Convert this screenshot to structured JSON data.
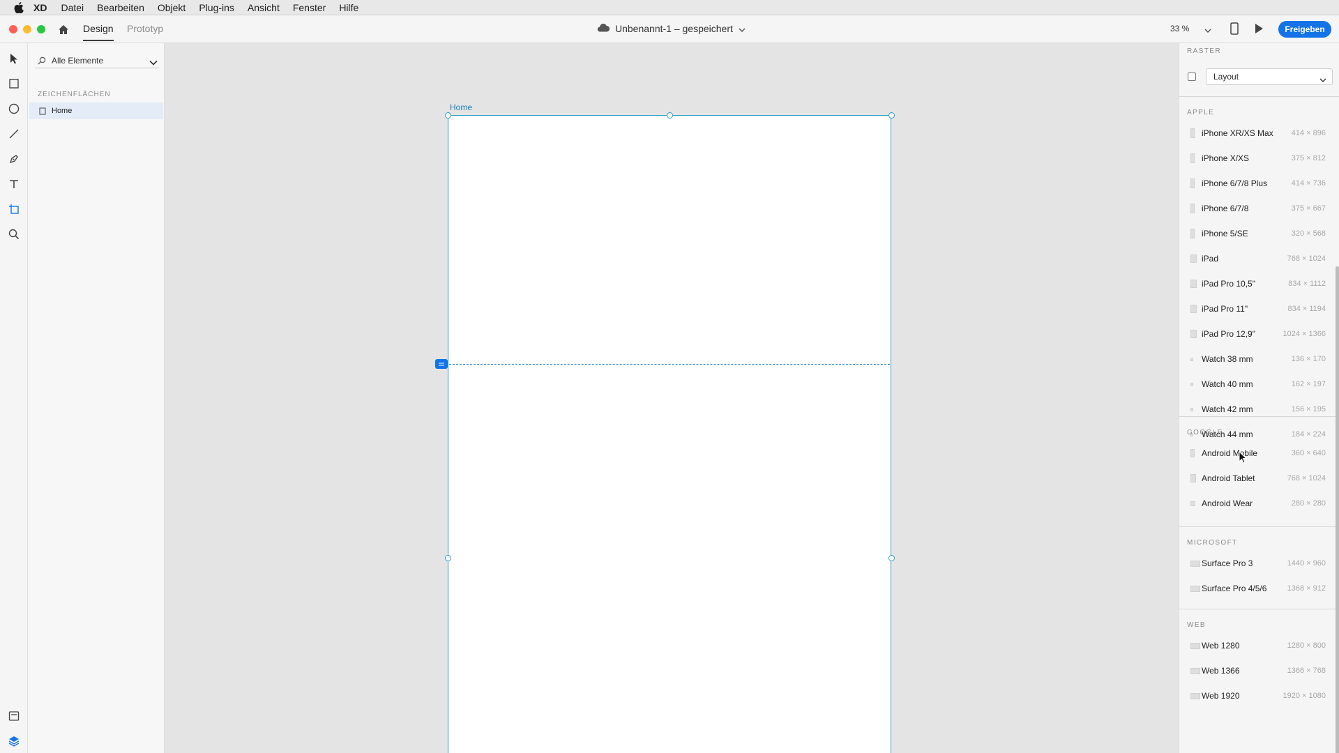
{
  "menubar": {
    "app": "XD",
    "items": [
      "Datei",
      "Bearbeiten",
      "Objekt",
      "Plug-ins",
      "Ansicht",
      "Fenster",
      "Hilfe"
    ]
  },
  "titlebar": {
    "tabs": {
      "design": "Design",
      "prototype": "Prototyp"
    },
    "document_title": "Unbenannt-1 – gespeichert",
    "zoom": "33 %",
    "share_label": "Freigeben",
    "colors": {
      "accent": "#1473e6",
      "close": "#ff5f57",
      "minimize": "#febc2e",
      "maximize": "#28c840"
    }
  },
  "layers": {
    "filter_label": "Alle Elemente",
    "section_label": "ZEICHENFLÄCHEN",
    "artboards": [
      "Home"
    ]
  },
  "canvas": {
    "artboard_name": "Home",
    "artboard_border_color": "#2aa0c9"
  },
  "inspector": {
    "grid_section": "RASTER",
    "grid_select": "Layout",
    "groups": [
      {
        "title": "APPLE",
        "presets": [
          {
            "name": "iPhone XR/XS Max",
            "size": "414 × 896"
          },
          {
            "name": "iPhone X/XS",
            "size": "375 × 812"
          },
          {
            "name": "iPhone 6/7/8 Plus",
            "size": "414 × 736"
          },
          {
            "name": "iPhone 6/7/8",
            "size": "375 × 667"
          },
          {
            "name": "iPhone 5/SE",
            "size": "320 × 568"
          },
          {
            "name": "iPad",
            "size": "768 × 1024"
          },
          {
            "name": "iPad Pro 10,5\"",
            "size": "834 × 1112"
          },
          {
            "name": "iPad Pro 11\"",
            "size": "834 × 1194"
          },
          {
            "name": "iPad Pro 12,9\"",
            "size": "1024 × 1366"
          },
          {
            "name": "Watch 38 mm",
            "size": "136 × 170"
          },
          {
            "name": "Watch 40 mm",
            "size": "162 × 197"
          },
          {
            "name": "Watch 42 mm",
            "size": "156 × 195"
          },
          {
            "name": "Watch 44 mm",
            "size": "184 × 224"
          }
        ]
      },
      {
        "title": "GOOGLE",
        "presets": [
          {
            "name": "Android Mobile",
            "size": "360 × 640"
          },
          {
            "name": "Android Tablet",
            "size": "768 × 1024"
          },
          {
            "name": "Android Wear",
            "size": "280 × 280"
          }
        ]
      },
      {
        "title": "MICROSOFT",
        "presets": [
          {
            "name": "Surface Pro 3",
            "size": "1440 × 960"
          },
          {
            "name": "Surface Pro 4/5/6",
            "size": "1368 × 912"
          }
        ]
      },
      {
        "title": "WEB",
        "presets": [
          {
            "name": "Web 1280",
            "size": "1280 × 800"
          },
          {
            "name": "Web 1366",
            "size": "1366 × 768"
          },
          {
            "name": "Web 1920",
            "size": "1920 × 1080"
          }
        ]
      }
    ]
  }
}
